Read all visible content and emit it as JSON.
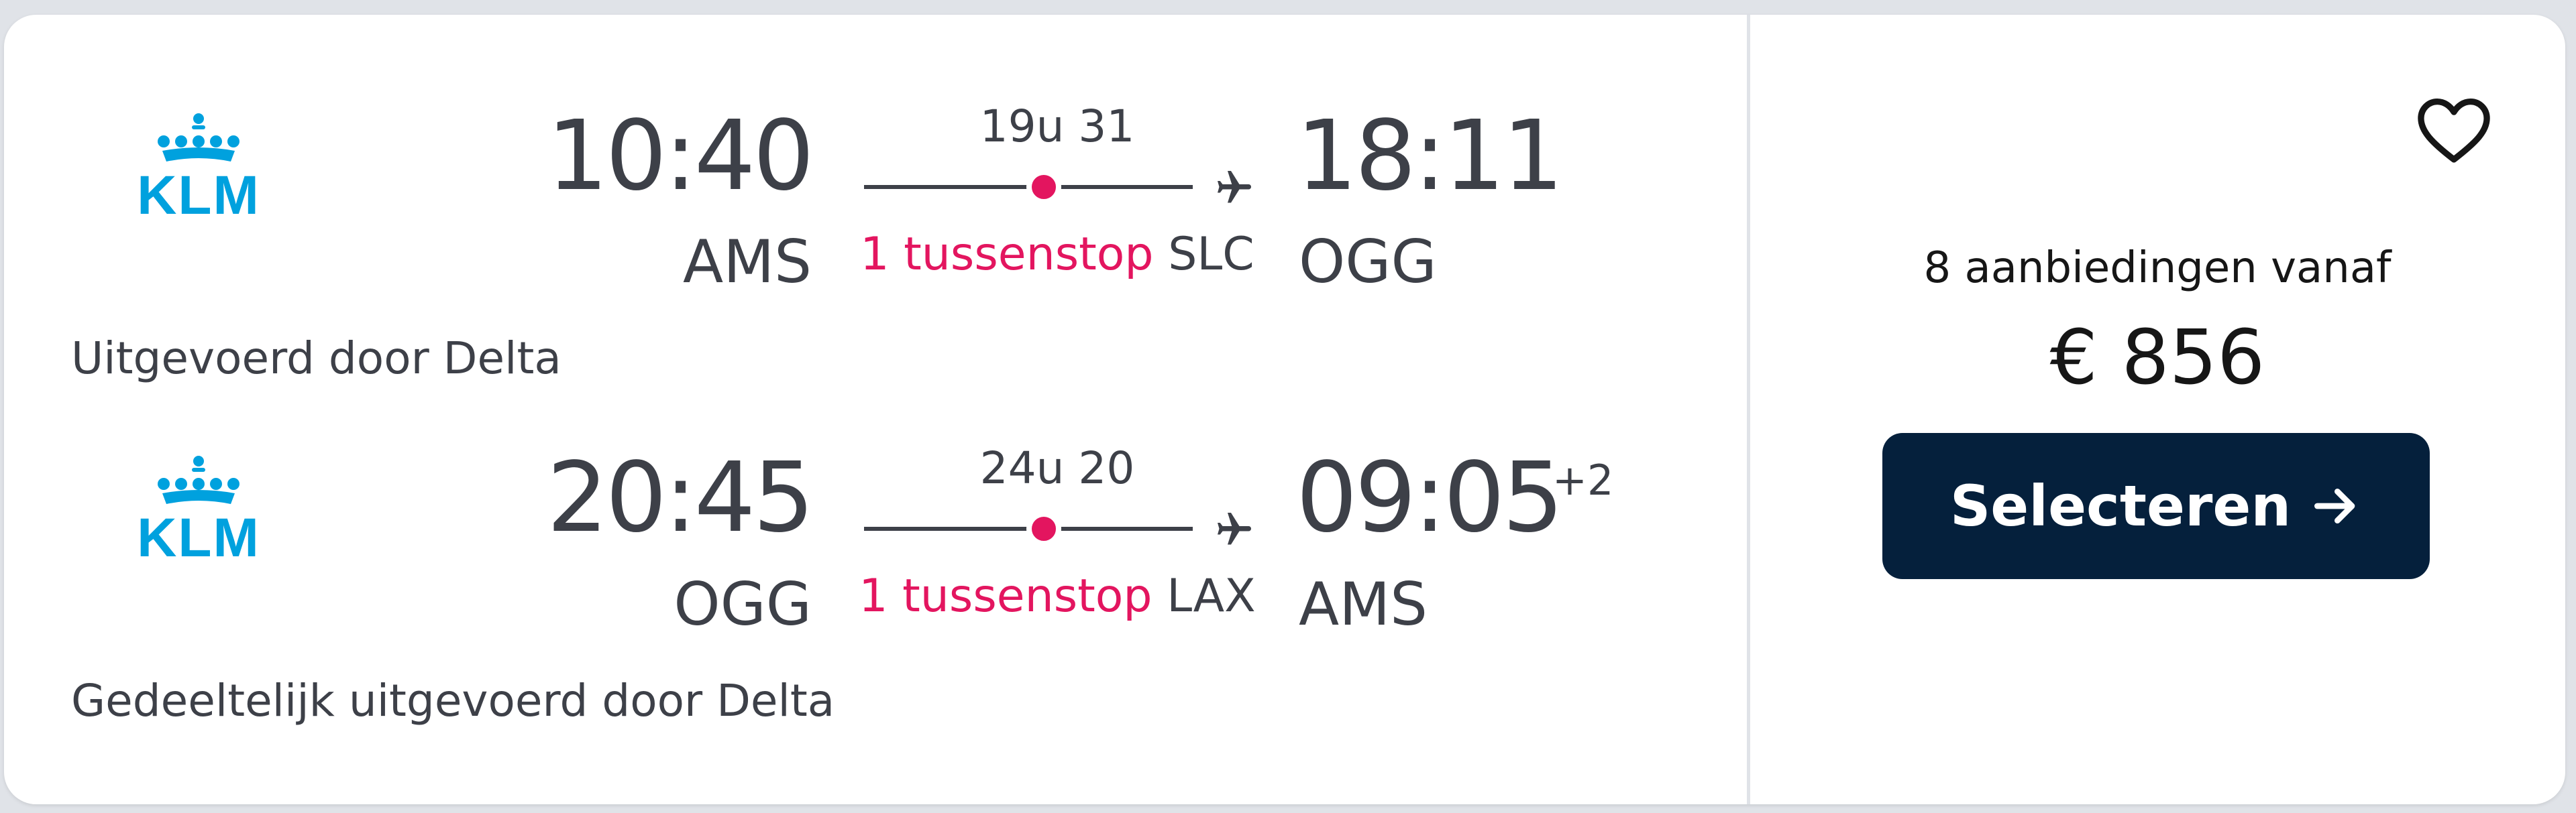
{
  "airline_logo_label": "KLM",
  "outbound": {
    "departure_time": "10:40",
    "departure_airport": "AMS",
    "duration": "19u 31",
    "stops_label": "1 tussenstop",
    "stop_airport": "SLC",
    "arrival_time": "18:11",
    "arrival_airport": "OGG",
    "operated_by": "Uitgevoerd door Delta"
  },
  "inbound": {
    "departure_time": "20:45",
    "departure_airport": "OGG",
    "duration": "24u 20",
    "stops_label": "1 tussenstop",
    "stop_airport": "LAX",
    "arrival_time": "09:05",
    "arrival_day_offset": "+2",
    "arrival_airport": "AMS",
    "operated_by": "Gedeeltelijk uitgevoerd door Delta"
  },
  "offer": {
    "offers_text": "8 aanbiedingen vanaf",
    "price": "€ 856",
    "select_label": "Selecteren"
  },
  "icons": {
    "favorite": "heart-outline-icon",
    "select_arrow": "arrow-right-icon",
    "plane": "plane-icon"
  },
  "colors": {
    "klm_blue": "#00a1de",
    "stop_pink": "#e3155f",
    "button_navy": "#05203c",
    "text_gray": "#3d4048"
  }
}
